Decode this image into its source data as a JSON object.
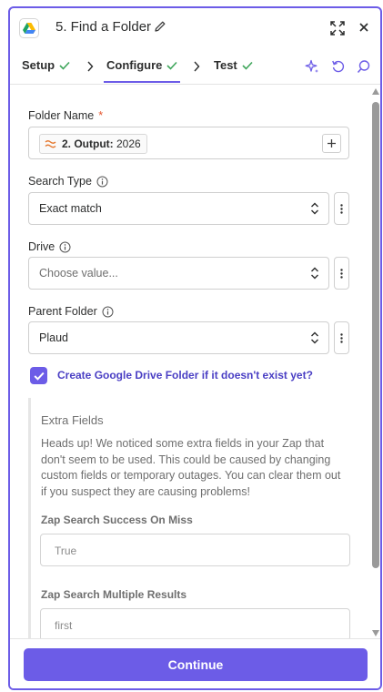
{
  "header": {
    "step_title": "5. Find a Folder",
    "app_icon": "google-drive-icon"
  },
  "tabs": [
    {
      "label": "Setup",
      "status": "complete"
    },
    {
      "label": "Configure",
      "status": "complete",
      "active": true
    },
    {
      "label": "Test",
      "status": "complete"
    }
  ],
  "form": {
    "folder_name": {
      "label": "Folder Name",
      "required_mark": "*",
      "pill_step": "2. Output:",
      "pill_value": "2026"
    },
    "search_type": {
      "label": "Search Type",
      "value": "Exact match"
    },
    "drive": {
      "label": "Drive",
      "placeholder": "Choose value..."
    },
    "parent_folder": {
      "label": "Parent Folder",
      "value": "Plaud"
    },
    "create_folder": {
      "label": "Create Google Drive Folder if it doesn't exist yet?",
      "checked": true
    }
  },
  "extra_fields": {
    "title": "Extra Fields",
    "line1": "Heads up! We noticed some extra fields in your Zap that",
    "line2": "don't seem to be used. This could be caused by changing",
    "line3": "custom fields or temporary outages. You can clear them out",
    "line4": "if you suspect they are causing problems!",
    "fields": [
      {
        "label": "Zap Search Success On Miss",
        "value": "True"
      },
      {
        "label": "Zap Search Multiple Results",
        "value": "first"
      }
    ]
  },
  "footer": {
    "continue_label": "Continue"
  },
  "colors": {
    "accent": "#6c5ce7",
    "success": "#3fa65b"
  }
}
